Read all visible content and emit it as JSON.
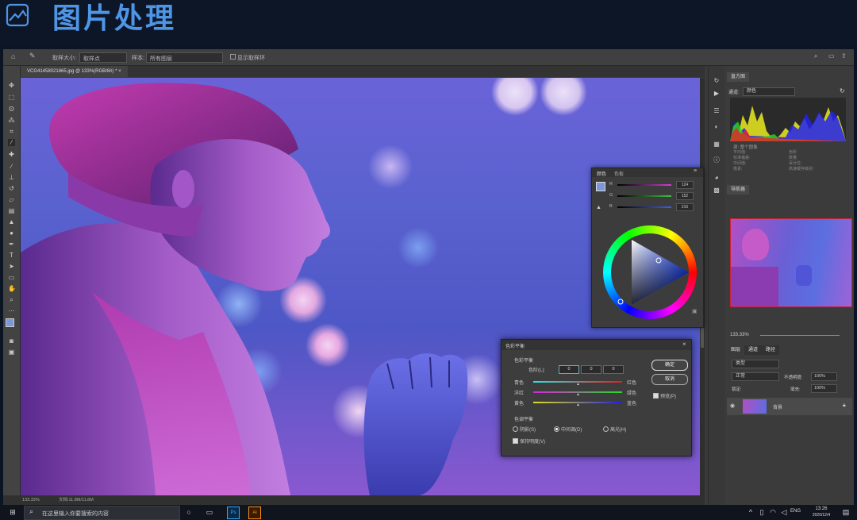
{
  "slide": {
    "title": "图片处理"
  },
  "app": {
    "options_bar": {
      "sample_label": "取样大小:",
      "sample_value": "取样点",
      "field2_label": "样本:",
      "field2_value": "所有图层",
      "checkbox_label": "显示取样环"
    },
    "document_tab": {
      "title": "VCG41458021865.jpg @ 133%(RGB/8#) *",
      "close": "×"
    },
    "status": {
      "zoom": "133.33%",
      "doc_size": "文档:11.8M/11.8M"
    }
  },
  "histogram_panel": {
    "tab": "直方图",
    "channel_label": "通道:",
    "channel_value": "颜色",
    "source_label": "源:",
    "source_value": "整个图像",
    "stats_labels": [
      "平均值:",
      "标准偏差:",
      "中间值:",
      "像素:"
    ],
    "stats_right_labels": [
      "色阶:",
      "数量:",
      "百分位:",
      "高速缓存级别:"
    ]
  },
  "navigator_panel": {
    "tab": "导航器",
    "zoom": "133.33%"
  },
  "color_panel": {
    "tabs": [
      "颜色",
      "色板"
    ],
    "sliders": [
      {
        "label": "R",
        "value": "124",
        "color": "#d040d0"
      },
      {
        "label": "G",
        "value": "152",
        "color": "#40c040"
      },
      {
        "label": "B",
        "value": "216",
        "color": "#4060e0"
      }
    ]
  },
  "color_balance": {
    "title": "色彩平衡",
    "section1": "色彩平衡",
    "levels_label": "色阶(L):",
    "levels": [
      "0",
      "0",
      "0"
    ],
    "sliders": [
      {
        "left": "青色",
        "right": "红色"
      },
      {
        "left": "洋红",
        "right": "绿色"
      },
      {
        "left": "黄色",
        "right": "蓝色"
      }
    ],
    "ok": "确定",
    "cancel": "取消",
    "preview": "预览(P)",
    "section2": "色调平衡",
    "tones": [
      "阴影(S)",
      "中间调(D)",
      "高光(H)"
    ],
    "preserve": "保持明度(V)"
  },
  "layers_panel": {
    "tabs": [
      "图层",
      "通道",
      "路径"
    ],
    "kind_label": "类型",
    "blend_mode": "正常",
    "opacity_label": "不透明度:",
    "opacity": "100%",
    "lock_label": "锁定:",
    "fill_label": "填充:",
    "fill": "100%",
    "layer_name": "背景"
  },
  "taskbar": {
    "search_placeholder": "在这里输入你要搜索的内容",
    "lang": "ENG",
    "time": "13:26",
    "date": "2020/12/4"
  }
}
